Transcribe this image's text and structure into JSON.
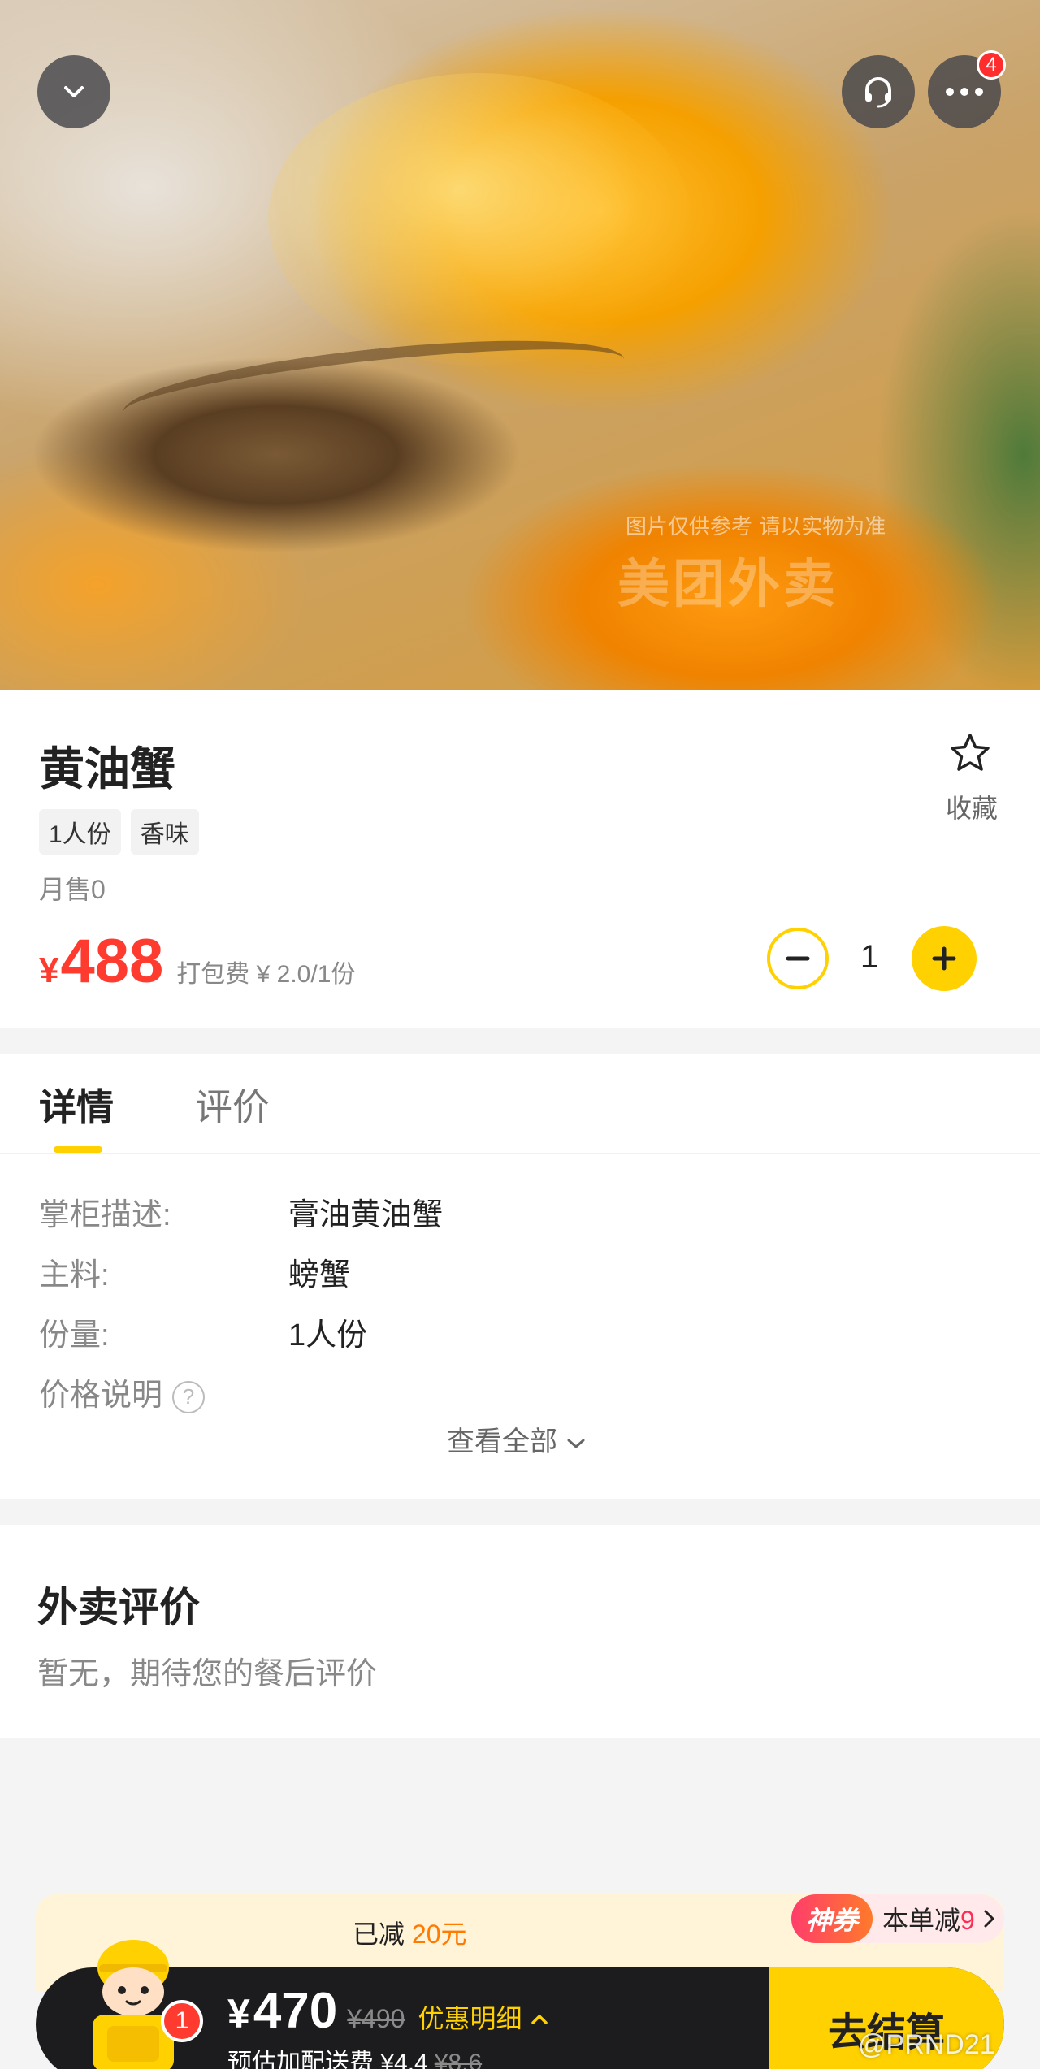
{
  "hero": {
    "watermark": "图片仅供参考 请以实物为准",
    "watermark_logo": "美团外卖",
    "menu_badge": "4"
  },
  "product": {
    "name": "黄油蟹",
    "favorite_label": "收藏",
    "tags": [
      "1人份",
      "香味"
    ],
    "monthly_sales": "月售0",
    "price_symbol": "¥",
    "price": "488",
    "packing_fee": "打包费 ¥ 2.0/1份",
    "quantity": "1"
  },
  "detail": {
    "tabs": [
      "详情",
      "评价"
    ],
    "rows": [
      {
        "key": "掌柜描述:",
        "value": "膏油黄油蟹"
      },
      {
        "key": "主料:",
        "value": "螃蟹"
      },
      {
        "key": "份量:",
        "value": "1人份"
      },
      {
        "key": "价格说明",
        "value": ""
      }
    ],
    "help_icon": "?",
    "view_all": "查看全部"
  },
  "reviews": {
    "title": "外卖评价",
    "empty_text": "暂无，期待您的餐后评价"
  },
  "promo": {
    "reduced_prefix": "已减",
    "reduced_amount": "20元",
    "coupon_tag": "神券",
    "coupon_prefix": "本单减",
    "coupon_amount": "9"
  },
  "cart": {
    "badge": "1",
    "total_symbol": "¥",
    "total": "470",
    "original_total": "¥490",
    "discount_link": "优惠明细",
    "fee_label": "预估加配送费 ¥4.4",
    "fee_original": "¥8.6",
    "checkout": "去结算"
  },
  "watermark_user": "@PRND21",
  "colors": {
    "accent": "#ffd100",
    "price": "#ff3b30",
    "cart_bar": "#1c1c1e"
  }
}
